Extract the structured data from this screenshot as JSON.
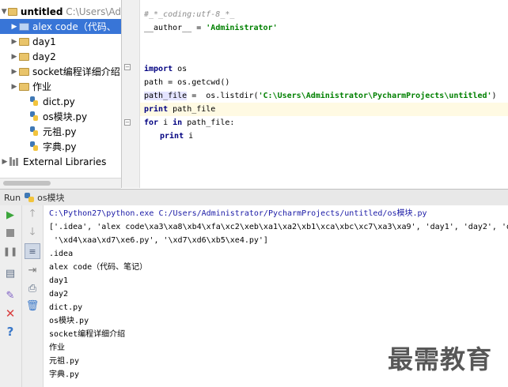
{
  "project_tree": {
    "root": {
      "name": "untitled",
      "path": "C:\\Users\\Ad"
    },
    "items": [
      {
        "label": "alex code（代码、",
        "type": "folder",
        "selected": true
      },
      {
        "label": "day1",
        "type": "folder"
      },
      {
        "label": "day2",
        "type": "folder"
      },
      {
        "label": "socket编程详细介绍",
        "type": "folder"
      },
      {
        "label": "作业",
        "type": "folder"
      },
      {
        "label": "dict.py",
        "type": "file"
      },
      {
        "label": "os模块.py",
        "type": "file"
      },
      {
        "label": "元祖.py",
        "type": "file"
      },
      {
        "label": "字典.py",
        "type": "file"
      }
    ],
    "external_libraries": "External Libraries"
  },
  "editor": {
    "line1": "#_*_coding:utf-8_*_",
    "author_kw": "__author__",
    "author_eq": " = ",
    "author_str": "'Administrator'",
    "import_kw": "import",
    "import_mod": " os",
    "path_line": "path = os.getcwd()",
    "pf_var": "path_file",
    "pf_eq": " =  os.listdir(",
    "pf_str": "'C:\\Users\\Administrator\\PycharmProjects\\untitled'",
    "pf_close": ")",
    "print_kw": "print",
    "print_arg": " path_file",
    "for_kw": "for",
    "for_i": " i ",
    "in_kw": "in",
    "for_rest": " path_file:",
    "print2_kw": "print",
    "print2_arg": " i"
  },
  "run_bar": {
    "label": "Run",
    "config": "os模块"
  },
  "console": {
    "command": "C:\\Python27\\python.exe C:/Users/Administrator/PycharmProjects/untitled/os模块.py",
    "list_line1": "['.idea', 'alex code\\xa3\\xa8\\xb4\\xfa\\xc2\\xeb\\xa1\\xa2\\xb1\\xca\\xbc\\xc7\\xa3\\xa9', 'day1', 'day2', 'dict.py', '",
    "list_line2": " '\\xd4\\xaa\\xd7\\xe6.py', '\\xd7\\xd6\\xb5\\xe4.py']",
    "outputs": [
      ".idea",
      "alex code（代码、笔记）",
      "day1",
      "day2",
      "dict.py",
      "os模块.py",
      "socket编程详细介绍",
      "作业",
      "元祖.py",
      "字典.py"
    ]
  },
  "watermark": "最需教育",
  "colors": {
    "selection": "#3875d7",
    "keyword": "#000080",
    "string": "#008000",
    "highlight": "#fffae3",
    "run_green": "#3ca63c",
    "stop_red": "#d93f3f"
  },
  "icons": [
    "folder-icon",
    "python-file-icon",
    "library-icon",
    "run-icon",
    "stop-icon",
    "pause-icon",
    "rerun-icon",
    "up-arrow-icon",
    "down-arrow-icon",
    "wrap-icon",
    "print-icon",
    "trash-icon",
    "pin-icon",
    "close-icon",
    "help-icon",
    "python-icon"
  ]
}
